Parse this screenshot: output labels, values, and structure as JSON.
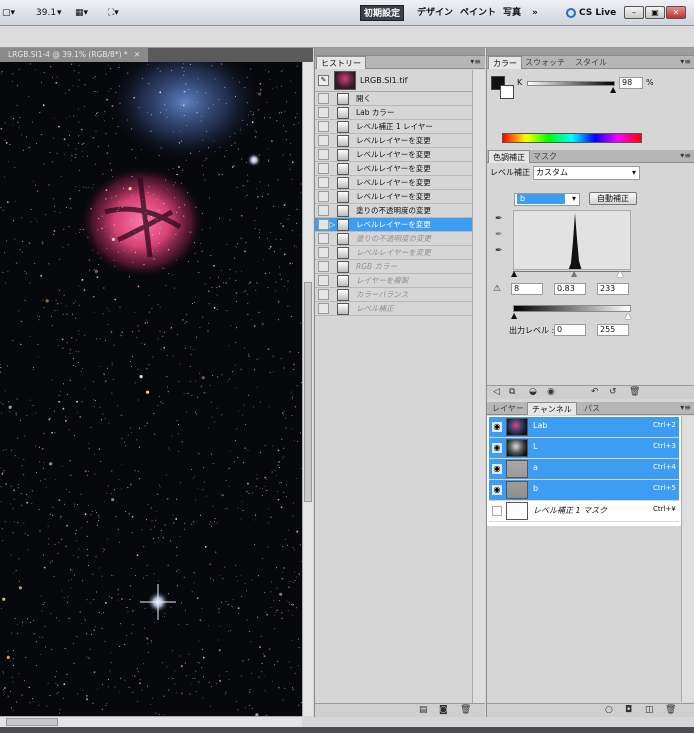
{
  "topbar": {
    "zoom": "39.1",
    "workspaces": [
      "初期設定",
      "デザイン",
      "ペイント",
      "写真"
    ],
    "more": "»",
    "cs_live": "CS Live",
    "window_buttons": [
      "–",
      "▣",
      "✕"
    ]
  },
  "document": {
    "tab_title": "LRGB.SI1-4 @ 39.1% (RGB/8*) *",
    "tab_close": "✕"
  },
  "history": {
    "tab": "ヒストリー",
    "snapshot": "LRGB.SI1.tif",
    "items": [
      {
        "label": "開く",
        "state": "normal"
      },
      {
        "label": "Lab カラー",
        "state": "normal"
      },
      {
        "label": "レベル補正 1 レイヤー",
        "state": "normal"
      },
      {
        "label": "レベルレイヤーを変更",
        "state": "normal"
      },
      {
        "label": "レベルレイヤーを変更",
        "state": "normal"
      },
      {
        "label": "レベルレイヤーを変更",
        "state": "normal"
      },
      {
        "label": "レベルレイヤーを変更",
        "state": "normal"
      },
      {
        "label": "レベルレイヤーを変更",
        "state": "normal"
      },
      {
        "label": "塗りの不透明度の変更",
        "state": "normal"
      },
      {
        "label": "レベルレイヤーを変更",
        "state": "selected"
      },
      {
        "label": "塗りの不透明度の変更",
        "state": "dim"
      },
      {
        "label": "レベルレイヤーを変更",
        "state": "dim"
      },
      {
        "label": "RGB カラー",
        "state": "dim"
      },
      {
        "label": "レイヤーを複製",
        "state": "dim"
      },
      {
        "label": "カラーバランス",
        "state": "dim"
      },
      {
        "label": "レベル補正",
        "state": "dim"
      }
    ]
  },
  "color": {
    "tabs": [
      "カラー",
      "スウォッチ",
      "スタイル"
    ],
    "channel": "K",
    "value": "98",
    "unit": "%"
  },
  "adjust": {
    "tabs": [
      "色調補正",
      "マスク"
    ],
    "label": "レベル補正",
    "preset": "カスタム",
    "channel": "b",
    "auto_label": "自動補正",
    "input_values": [
      "8",
      "0.83",
      "233"
    ],
    "output_label": "出力レベル :",
    "output_values": [
      "0",
      "255"
    ]
  },
  "layers": {
    "tabs": [
      "レイヤー",
      "チャンネル",
      "パス"
    ],
    "channels": [
      {
        "name": "Lab",
        "key": "Ctrl+2",
        "selected": true,
        "visible": true
      },
      {
        "name": "L",
        "key": "Ctrl+3",
        "selected": true,
        "visible": true
      },
      {
        "name": "a",
        "key": "Ctrl+4",
        "selected": true,
        "visible": true
      },
      {
        "name": "b",
        "key": "Ctrl+5",
        "selected": true,
        "visible": true
      },
      {
        "name": "レベル補正 1 マスク",
        "key": "Ctrl+¥",
        "selected": false,
        "visible": false
      }
    ]
  },
  "colors": {
    "selection": "#3d9df2",
    "nebula_pink": "#e0457a",
    "nebula_blue": "#5b7fc4"
  }
}
